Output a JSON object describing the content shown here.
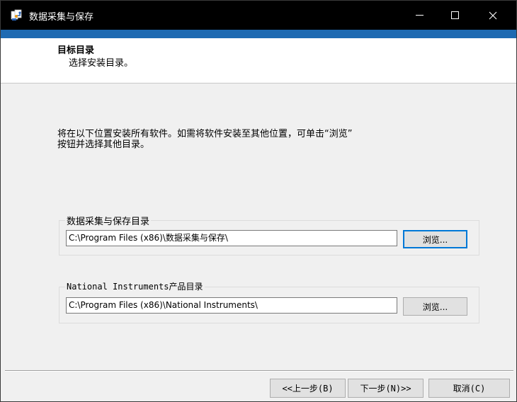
{
  "window": {
    "title": "数据采集与保存",
    "controls": {
      "minimize": "minimize",
      "maximize": "maximize",
      "close": "close"
    }
  },
  "header": {
    "title": "目标目录",
    "subtitle": "选择安装目录。"
  },
  "info": {
    "line1": "将在以下位置安装所有软件。如需将软件安装至其他位置，可单击“浏览”",
    "line2": "按钮并选择其他目录。"
  },
  "groups": [
    {
      "label": "数据采集与保存目录",
      "path": "C:\\Program Files (x86)\\数据采集与保存\\",
      "browse_label": "浏览..."
    },
    {
      "label": "National Instruments产品目录",
      "path": "C:\\Program Files (x86)\\National Instruments\\",
      "browse_label": "浏览..."
    }
  ],
  "buttons": {
    "back": "<<上一步(B)",
    "next": "下一步(N)>>",
    "cancel": "取消(C)"
  },
  "colors": {
    "titlebar": "#000000",
    "accent": "#1e6ab2",
    "focus": "#0078d7"
  }
}
